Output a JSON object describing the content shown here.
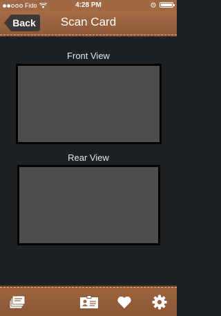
{
  "status_bar": {
    "carrier": "Fido",
    "time": "4:28 PM"
  },
  "header": {
    "back_label": "Back",
    "title": "Scan Card"
  },
  "front": {
    "label": "Front View"
  },
  "rear": {
    "label": "Rear View"
  },
  "tabs": [
    {
      "icon": "cards-stack-icon"
    },
    {
      "icon": "id-card-icon"
    },
    {
      "icon": "heart-icon"
    },
    {
      "icon": "gear-icon"
    }
  ],
  "colors": {
    "leather": "#9c653f",
    "background": "#1d2124",
    "frame_fill": "#4d4b4c"
  }
}
